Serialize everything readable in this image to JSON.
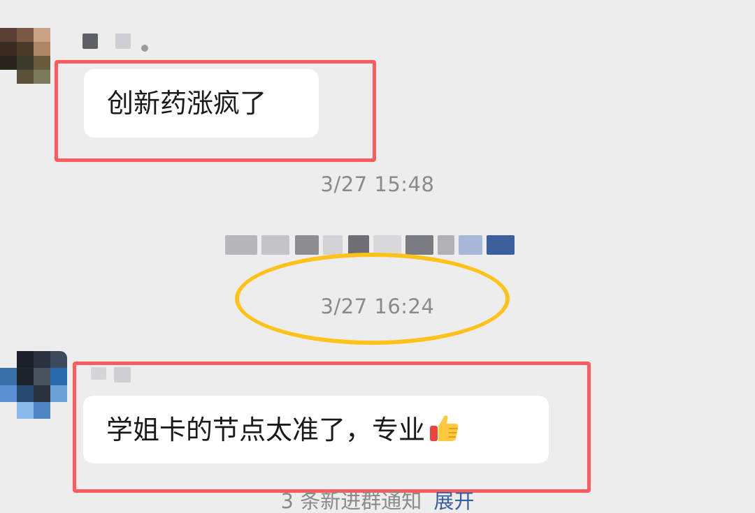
{
  "messages": [
    {
      "text": "创新药涨疯了"
    },
    {
      "text": "学姐卡的节点太准了，专业",
      "emoji": "thumbs-up"
    }
  ],
  "timestamps": [
    "3/27 15:48",
    "3/27 16:24"
  ],
  "notice": {
    "text": "3 条新进群通知",
    "action": "展开"
  },
  "colors": {
    "background": "#ededed",
    "bubble": "#ffffff",
    "highlight_rect": "#ff5a5f",
    "highlight_ellipse": "#ffc21a",
    "timestamp": "#8a8a8a",
    "link": "#3a5f9b"
  }
}
